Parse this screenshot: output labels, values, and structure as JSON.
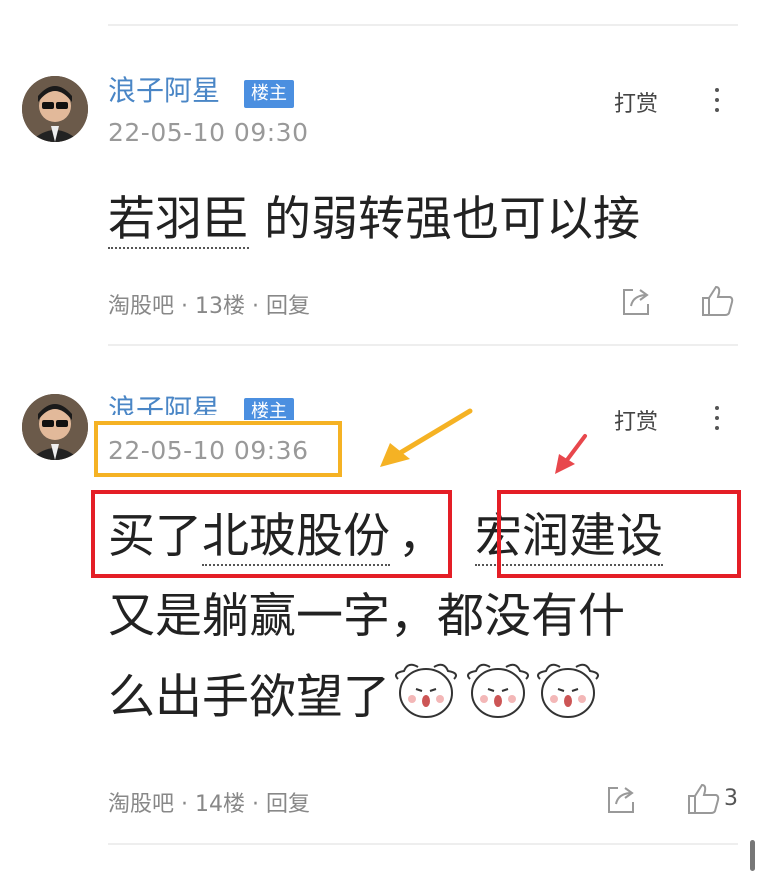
{
  "posts": [
    {
      "author": "浪子阿星",
      "badge": "楼主",
      "time": "22-05-10 09:30",
      "reward": "打赏",
      "content_parts": [
        "若羽臣",
        " 的弱转强也可以接"
      ],
      "meta": "淘股吧 · 13楼 · 回复",
      "like_count": ""
    },
    {
      "author": "浪子阿星",
      "badge": "楼主",
      "time": "22-05-10 09:36",
      "reward": "打赏",
      "content_parts": [
        "买了",
        "北玻股份",
        "，",
        "宏润建设",
        "又是躺赢一字，都没有什",
        "么出手欲望了"
      ],
      "meta": "淘股吧 · 14楼 · 回复",
      "like_count": "3"
    }
  ],
  "annotations": {
    "highlight_red": "#e41e26",
    "highlight_yellow": "#f5b224",
    "arrow_yellow": "#f5b224",
    "arrow_red": "#e8474c"
  },
  "icons": [
    "more-vertical-icon",
    "share-icon",
    "thumbs-up-icon",
    "sheep-emoji-icon"
  ]
}
